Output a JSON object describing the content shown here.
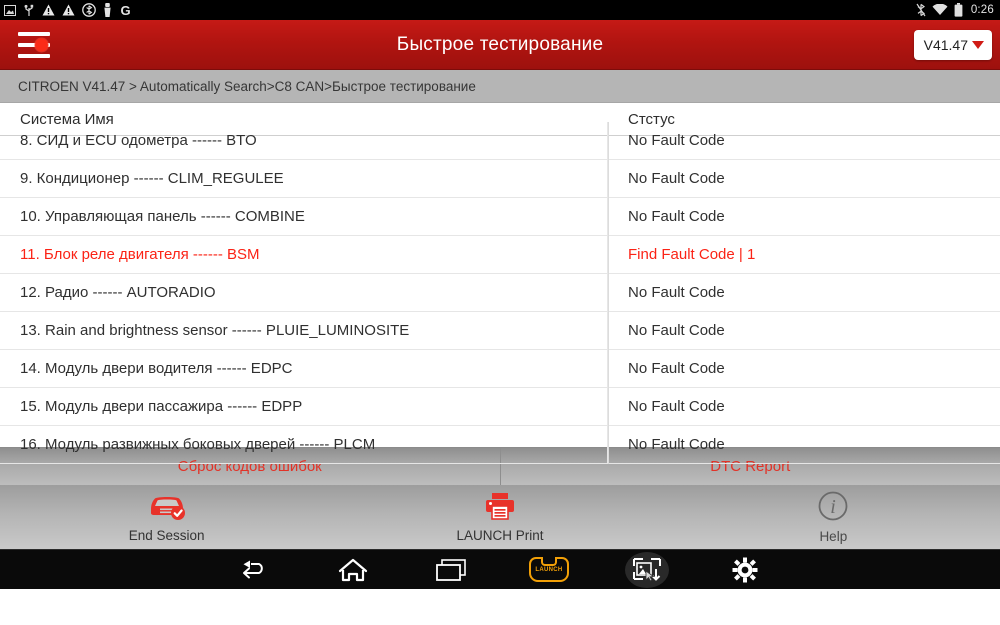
{
  "statusbar": {
    "left_icons": [
      "image-icon",
      "usb-icon",
      "warning-icon",
      "warning-icon",
      "bluetooth-circle-icon",
      "vehicle-connector-icon",
      "g-letter-icon"
    ],
    "right_icons": [
      "bluetooth-off-icon",
      "wifi-icon",
      "battery-icon"
    ],
    "time": "0:26"
  },
  "appbar": {
    "menu_icon": "hamburger-menu-icon",
    "notification_dot": "notification-dot",
    "title": "Быстрое тестирование",
    "version_button": "V41.47",
    "version_caret": "chevron-down-icon"
  },
  "breadcrumb": "CITROEN V41.47 > Automatically Search>C8 CAN>Быстрое тестирование",
  "table": {
    "headers": [
      "Система Имя",
      "Стстус"
    ],
    "rows": [
      {
        "name": "8. СИД и ECU одометра ------ BTO",
        "status": "No Fault Code",
        "fault": false
      },
      {
        "name": "9. Кондиционер ------ CLIM_REGULEE",
        "status": "No Fault Code",
        "fault": false
      },
      {
        "name": "10. Управляющая панель ------ COMBINE",
        "status": "No Fault Code",
        "fault": false
      },
      {
        "name": "11. Блок реле двигателя ------ BSM",
        "status": "Find Fault Code | 1",
        "fault": true
      },
      {
        "name": "12. Радио ------ AUTORADIO",
        "status": "No Fault Code",
        "fault": false
      },
      {
        "name": "13. Rain and brightness sensor ------ PLUIE_LUMINOSITE",
        "status": "No Fault Code",
        "fault": false
      },
      {
        "name": "14. Модуль двери водителя ------ EDPC",
        "status": "No Fault Code",
        "fault": false
      },
      {
        "name": "15. Модуль двери пассажира ------ EDPP",
        "status": "No Fault Code",
        "fault": false
      },
      {
        "name": "16. Модуль развижных боковых дверей ------ PLCM",
        "status": "No Fault Code",
        "fault": false
      }
    ]
  },
  "actions": [
    {
      "label": "Сброс кодов ошибок",
      "name": "clear-fault-codes-button"
    },
    {
      "label": "DTC Report",
      "name": "dtc-report-button"
    }
  ],
  "tools": [
    {
      "label": "End Session",
      "icon": "car-check-icon"
    },
    {
      "label": "LAUNCH Print",
      "icon": "printer-icon"
    },
    {
      "label": "Help",
      "icon": "info-circle-icon"
    }
  ],
  "navbar": {
    "items": [
      "back-icon",
      "home-icon",
      "recents-icon",
      "launch-logo-icon",
      "screenshot-icon",
      "settings-gear-icon"
    ]
  },
  "colors": {
    "brand_red": "#b01410",
    "accent_red": "#fb2316",
    "action_red": "#e23227",
    "launch_orange": "#f2a007",
    "breadcrumb_bg": "#b5b5b5"
  }
}
